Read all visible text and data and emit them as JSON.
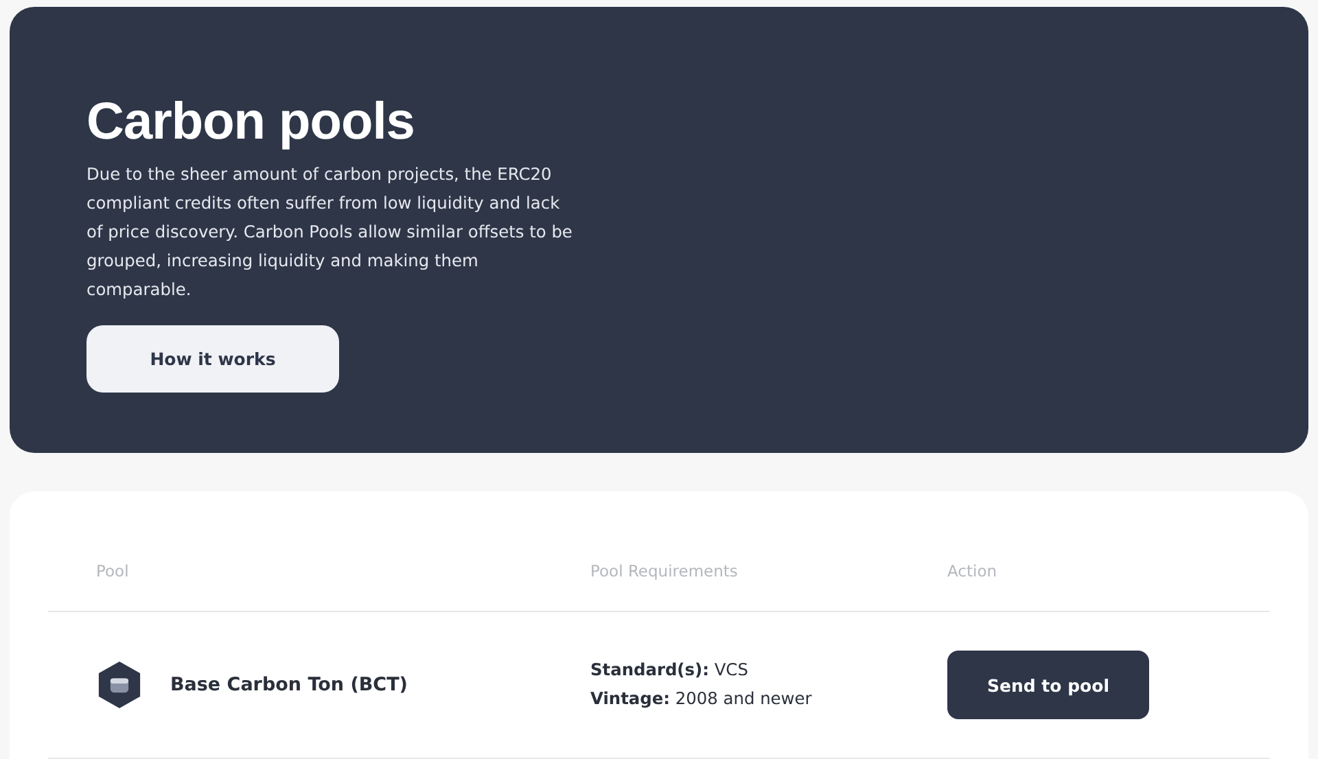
{
  "hero": {
    "title": "Carbon pools",
    "description": "Due to the sheer amount of carbon projects, the ERC20 compliant credits often suffer from low liquidity and lack of price discovery. Carbon Pools allow similar offsets to be grouped, increasing liquidity and making them comparable.",
    "button": "How it works"
  },
  "table": {
    "columns": [
      "Pool",
      "Pool Requirements",
      "Action"
    ],
    "rows": [
      {
        "pool": "Base Carbon Ton (BCT)",
        "requirements": [
          "**Standard(s):** VCS",
          "**Vintage:** 2008 and newer"
        ],
        "action": "Send to pool"
      }
    ]
  }
}
